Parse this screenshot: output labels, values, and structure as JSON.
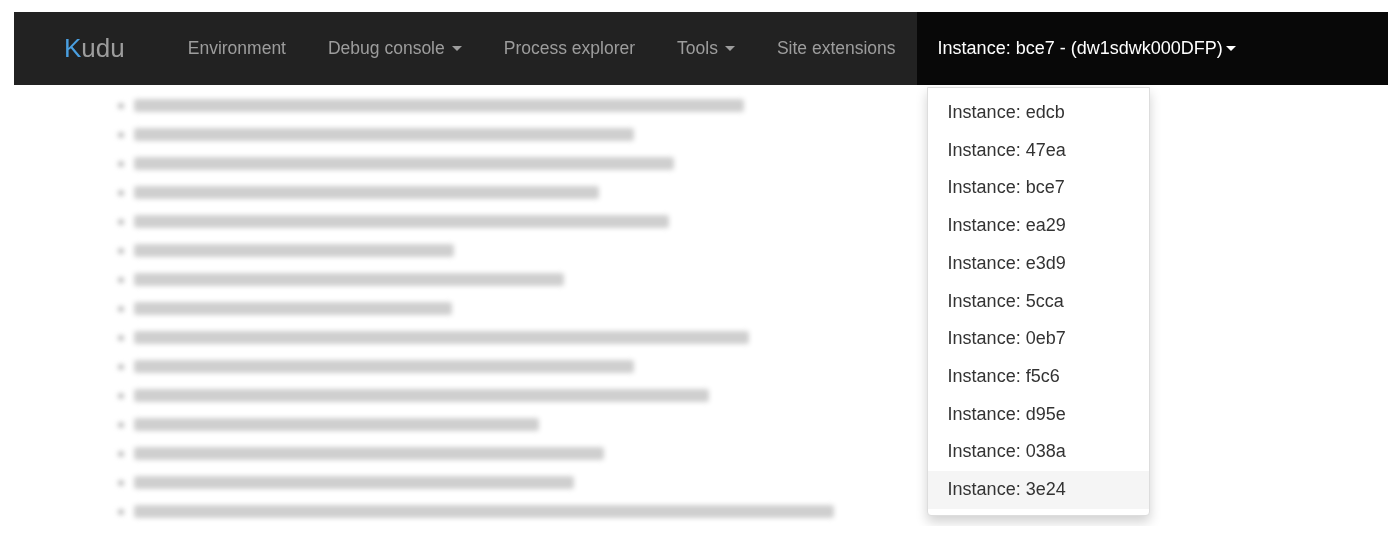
{
  "navbar": {
    "brand": "Kudu",
    "items": [
      {
        "label": "Environment",
        "dropdown": false
      },
      {
        "label": "Debug console",
        "dropdown": true
      },
      {
        "label": "Process explorer",
        "dropdown": false
      },
      {
        "label": "Tools",
        "dropdown": true
      },
      {
        "label": "Site extensions",
        "dropdown": false
      }
    ],
    "instance_menu": {
      "label": "Instance: bce7 - (dw1sdwk000DFP)",
      "expanded": true,
      "items": [
        {
          "label": "Instance: edcb",
          "hovered": false
        },
        {
          "label": "Instance: 47ea",
          "hovered": false
        },
        {
          "label": "Instance: bce7",
          "hovered": false
        },
        {
          "label": "Instance: ea29",
          "hovered": false
        },
        {
          "label": "Instance: e3d9",
          "hovered": false
        },
        {
          "label": "Instance: 5cca",
          "hovered": false
        },
        {
          "label": "Instance: 0eb7",
          "hovered": false
        },
        {
          "label": "Instance: f5c6",
          "hovered": false
        },
        {
          "label": "Instance: d95e",
          "hovered": false
        },
        {
          "label": "Instance: 038a",
          "hovered": false
        },
        {
          "label": "Instance: 3e24",
          "hovered": true
        }
      ]
    }
  },
  "content": {
    "kind": "blurred"
  }
}
